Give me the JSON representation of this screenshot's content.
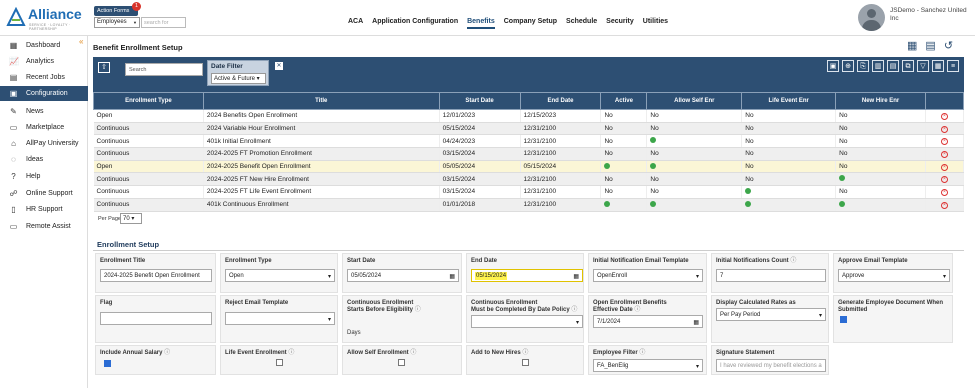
{
  "brand": {
    "name": "Alliance",
    "tagline": "SERVICE · LOYALTY · PARTNERSHIP"
  },
  "action_forms": {
    "label": "Action Forms",
    "badge": "1",
    "select_value": "Employees",
    "search_placeholder": "search for"
  },
  "nav": [
    "ACA",
    "Application Configuration",
    "Benefits",
    "Company Setup",
    "Schedule",
    "Security",
    "Utilities"
  ],
  "user": {
    "name": "JSDemo - Sanchez United Inc"
  },
  "sidebar": {
    "items": [
      {
        "label": "Dashboard",
        "icon": "dashboard-icon"
      },
      {
        "label": "Analytics",
        "icon": "analytics-icon"
      },
      {
        "label": "Recent Jobs",
        "icon": "jobs-icon"
      },
      {
        "label": "Configuration",
        "icon": "configuration-icon",
        "active": true
      },
      {
        "label": "News",
        "icon": "news-icon"
      },
      {
        "label": "Marketplace",
        "icon": "marketplace-icon"
      },
      {
        "label": "AllPay University",
        "icon": "university-icon"
      },
      {
        "label": "Ideas",
        "icon": "lightbulb-icon"
      },
      {
        "label": "Help",
        "icon": "help-icon"
      },
      {
        "label": "Online Support",
        "icon": "support-icon"
      },
      {
        "label": "HR Support",
        "icon": "hr-support-icon"
      },
      {
        "label": "Remote Assist",
        "icon": "monitor-icon"
      }
    ]
  },
  "page": {
    "title": "Benefit Enrollment Setup"
  },
  "toolbar": {
    "search_placeholder": "Search",
    "date_filter_label": "Date Filter",
    "date_filter_value": "Active & Future"
  },
  "grid": {
    "columns": [
      "Enrollment Type",
      "Title",
      "Start Date",
      "End Date",
      "Active",
      "Allow Self Enr",
      "Life Event Enr",
      "New Hire Enr"
    ],
    "rows": [
      {
        "type": "Open",
        "title": "2024 Benefits Open Enrollment",
        "start": "12/01/2023",
        "end": "12/15/2023",
        "active": "No",
        "self": "No",
        "life": "No",
        "newhire": "No"
      },
      {
        "type": "Continuous",
        "title": "2024 Variable Hour Enrollment",
        "start": "05/15/2024",
        "end": "12/31/2100",
        "active": "No",
        "self": "No",
        "life": "No",
        "newhire": "No"
      },
      {
        "type": "Continuous",
        "title": "401k Initial Enrollment",
        "start": "04/24/2023",
        "end": "12/31/2100",
        "active": "No",
        "self": "check",
        "life": "No",
        "newhire": "No"
      },
      {
        "type": "Continuous",
        "title": "2024-2025 FT Promotion Enrollment",
        "start": "03/15/2024",
        "end": "12/31/2100",
        "active": "No",
        "self": "No",
        "life": "No",
        "newhire": "No"
      },
      {
        "type": "Open",
        "title": "2024-2025 Benefit Open Enrollment",
        "start": "05/05/2024",
        "end": "05/15/2024",
        "active": "check",
        "self": "check",
        "life": "No",
        "newhire": "No"
      },
      {
        "type": "Continuous",
        "title": "2024-2025 FT New Hire Enrollment",
        "start": "03/15/2024",
        "end": "12/31/2100",
        "active": "No",
        "self": "No",
        "life": "No",
        "newhire": "check"
      },
      {
        "type": "Continuous",
        "title": "2024-2025 FT Life Event Enrollment",
        "start": "03/15/2024",
        "end": "12/31/2100",
        "active": "No",
        "self": "No",
        "life": "check",
        "newhire": "No"
      },
      {
        "type": "Continuous",
        "title": "401k Continuous Enrollment",
        "start": "01/01/2018",
        "end": "12/31/2100",
        "active": "check",
        "self": "check",
        "life": "check",
        "newhire": "check"
      }
    ]
  },
  "paging": {
    "per_page_label": "Per Page",
    "per_page_value": "70"
  },
  "setup": {
    "heading": "Enrollment Setup",
    "enrollment_title": {
      "label": "Enrollment Title",
      "value": "2024-2025 Benefit Open Enrollment"
    },
    "enrollment_type": {
      "label": "Enrollment Type",
      "value": "Open"
    },
    "start_date": {
      "label": "Start Date",
      "value": "05/05/2024"
    },
    "end_date": {
      "label": "End Date",
      "value": "05/15/2024"
    },
    "initial_template": {
      "label": "Initial Notification Email Template",
      "value": "OpenEnroll"
    },
    "initial_count": {
      "label": "Initial Notifications Count",
      "value": "7"
    },
    "approve_template": {
      "label": "Approve Email Template",
      "value": "Approve"
    },
    "flag": {
      "label": "Flag",
      "value": ""
    },
    "reject_template": {
      "label": "Reject Email Template",
      "value": ""
    },
    "cont_starts": {
      "label1": "Continuous Enrollment",
      "label2": "Starts Before Eligibility",
      "suffix": "Days"
    },
    "cont_must": {
      "label1": "Continuous Enrollment",
      "label2": "Must be Completed By Date Policy"
    },
    "open_effective": {
      "label1": "Open Enrollment Benefits",
      "label2": "Effective Date",
      "value": "7/1/2024"
    },
    "display_rates": {
      "label": "Display Calculated Rates as",
      "value": "Per Pay Period"
    },
    "gen_doc": {
      "label1": "Generate Employee Document When",
      "label2": "Submitted"
    },
    "annual_salary": {
      "label": "Include Annual Salary"
    },
    "life_event": {
      "label": "Life Event Enrollment"
    },
    "allow_self": {
      "label": "Allow Self Enrollment"
    },
    "new_hires": {
      "label": "Add to New Hires"
    },
    "employee_filter": {
      "label": "Employee Filter",
      "value": "FA_BenElig"
    },
    "signature": {
      "label": "Signature Statement",
      "placeholder": "I have reviewed my benefit elections a"
    }
  }
}
